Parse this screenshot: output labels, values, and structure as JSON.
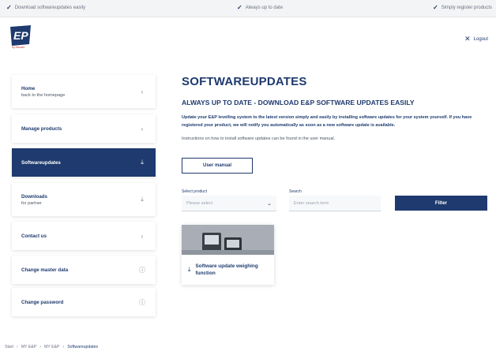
{
  "topbar": {
    "items": [
      {
        "label": "Download softwareupdates easily",
        "icon": "check-icon"
      },
      {
        "label": "Always up to date",
        "icon": "check-icon"
      },
      {
        "label": "Simply register products",
        "icon": "check-icon"
      }
    ]
  },
  "header": {
    "logo_text": "EP",
    "logo_sub": "by Actuant",
    "logout_label": "Logout"
  },
  "sidebar": {
    "items": [
      {
        "label": "Home",
        "sub": "back to the homepage",
        "icon": "chevron-left-icon",
        "glyph": "‹"
      },
      {
        "label": "Manage products",
        "sub": "",
        "icon": "chevron-left-icon",
        "glyph": "‹"
      },
      {
        "label": "Softwareupdates",
        "sub": "",
        "icon": "download-icon",
        "glyph": "⤓"
      },
      {
        "label": "Downloads",
        "sub": "for partner",
        "icon": "download-icon",
        "glyph": "⤓"
      },
      {
        "label": "Contact us",
        "sub": "",
        "icon": "chevron-left-icon",
        "glyph": "‹"
      },
      {
        "label": "Change master data",
        "sub": "",
        "icon": "info-icon",
        "glyph": "ⓘ"
      },
      {
        "label": "Change password",
        "sub": "",
        "icon": "info-icon",
        "glyph": "ⓘ"
      }
    ]
  },
  "main": {
    "title": "SOFTWAREUPDATES",
    "subtitle": "ALWAYS UP TO DATE - DOWNLOAD E&P SOFTWARE UPDATES EASILY",
    "intro": "Update your E&P levelling system to the latest version simply and easily by installing software updates for your system yourself. If you have registered your product, we will notify you automatically as soon as a new software update is available.",
    "instructions": "Instructions on how to install software updates can be found in the user manual.",
    "manual_button": "User manual",
    "filter": {
      "select_label": "Select product",
      "select_placeholder": "Please select",
      "search_label": "Search",
      "search_placeholder": "Enter search term",
      "button": "Filter"
    },
    "card": {
      "title": "Software update weighing function"
    }
  },
  "breadcrumb": {
    "items": [
      "Start",
      "MY E&P",
      "MY E&P",
      "Softwareupdates"
    ]
  },
  "colors": {
    "primary": "#1e3a6e",
    "topbar_bg": "#f3f4f6"
  }
}
